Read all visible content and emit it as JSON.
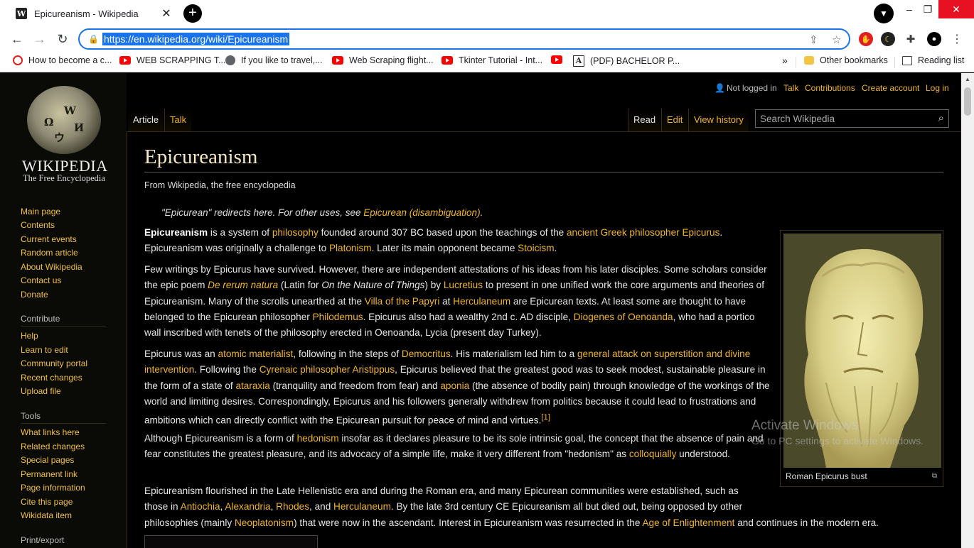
{
  "tab": {
    "favicon": "W",
    "title": "Epicureanism - Wikipedia",
    "close": "✕"
  },
  "window": {
    "minimize": "–",
    "restore": "❐",
    "close": "✕"
  },
  "toolbar": {
    "back": "←",
    "forward": "→",
    "reload": "↻",
    "url": "https://en.wikipedia.org/wiki/Epicureanism"
  },
  "bookmarks": [
    {
      "label": "How to become a c...",
      "icon": "opera-icon"
    },
    {
      "label": "WEB SCRAPPING T...",
      "icon": "youtube-icon"
    },
    {
      "label": "If you like to travel,...",
      "icon": "globe-icon"
    },
    {
      "label": "Web Scraping flight...",
      "icon": "youtube-icon"
    },
    {
      "label": "Tkinter Tutorial - Int...",
      "icon": "youtube-icon"
    },
    {
      "label": "",
      "icon": "youtube-icon"
    },
    {
      "label": "(PDF) BACHELOR P...",
      "icon": "academia-icon"
    }
  ],
  "bookmarks_more": "»",
  "other_bookmarks": "Other bookmarks",
  "reading_list": "Reading list",
  "logo": {
    "word": "WIKIPEDIA",
    "tagline": "The Free Encyclopedia"
  },
  "sidebar": {
    "navigation": [
      "Main page",
      "Contents",
      "Current events",
      "Random article",
      "About Wikipedia",
      "Contact us",
      "Donate"
    ],
    "contribute_heading": "Contribute",
    "contribute": [
      "Help",
      "Learn to edit",
      "Community portal",
      "Recent changes",
      "Upload file"
    ],
    "tools_heading": "Tools",
    "tools": [
      "What links here",
      "Related changes",
      "Special pages",
      "Permanent link",
      "Page information",
      "Cite this page",
      "Wikidata item"
    ],
    "printexport_heading": "Print/export"
  },
  "usertools": {
    "not_logged_in": "Not logged in",
    "talk": "Talk",
    "contributions": "Contributions",
    "create_account": "Create account",
    "log_in": "Log in"
  },
  "tabs": {
    "article": "Article",
    "talk": "Talk",
    "read": "Read",
    "edit": "Edit",
    "view_history": "View history"
  },
  "search": {
    "placeholder": "Search Wikipedia"
  },
  "article": {
    "title": "Epicureanism",
    "from": "From Wikipedia, the free encyclopedia",
    "hatnote": {
      "pre": "\"Epicurean\" redirects here. For other uses, see ",
      "link": "Epicurean (disambiguation)",
      "post": "."
    },
    "caption": "Roman Epicurus bust"
  },
  "watermark": {
    "line1": "Activate Windows",
    "line2": "Go to PC settings to activate Windows."
  },
  "colors": {
    "link": "#f0b429",
    "background": "#000000",
    "omnibox_focus": "#1a73e8"
  }
}
